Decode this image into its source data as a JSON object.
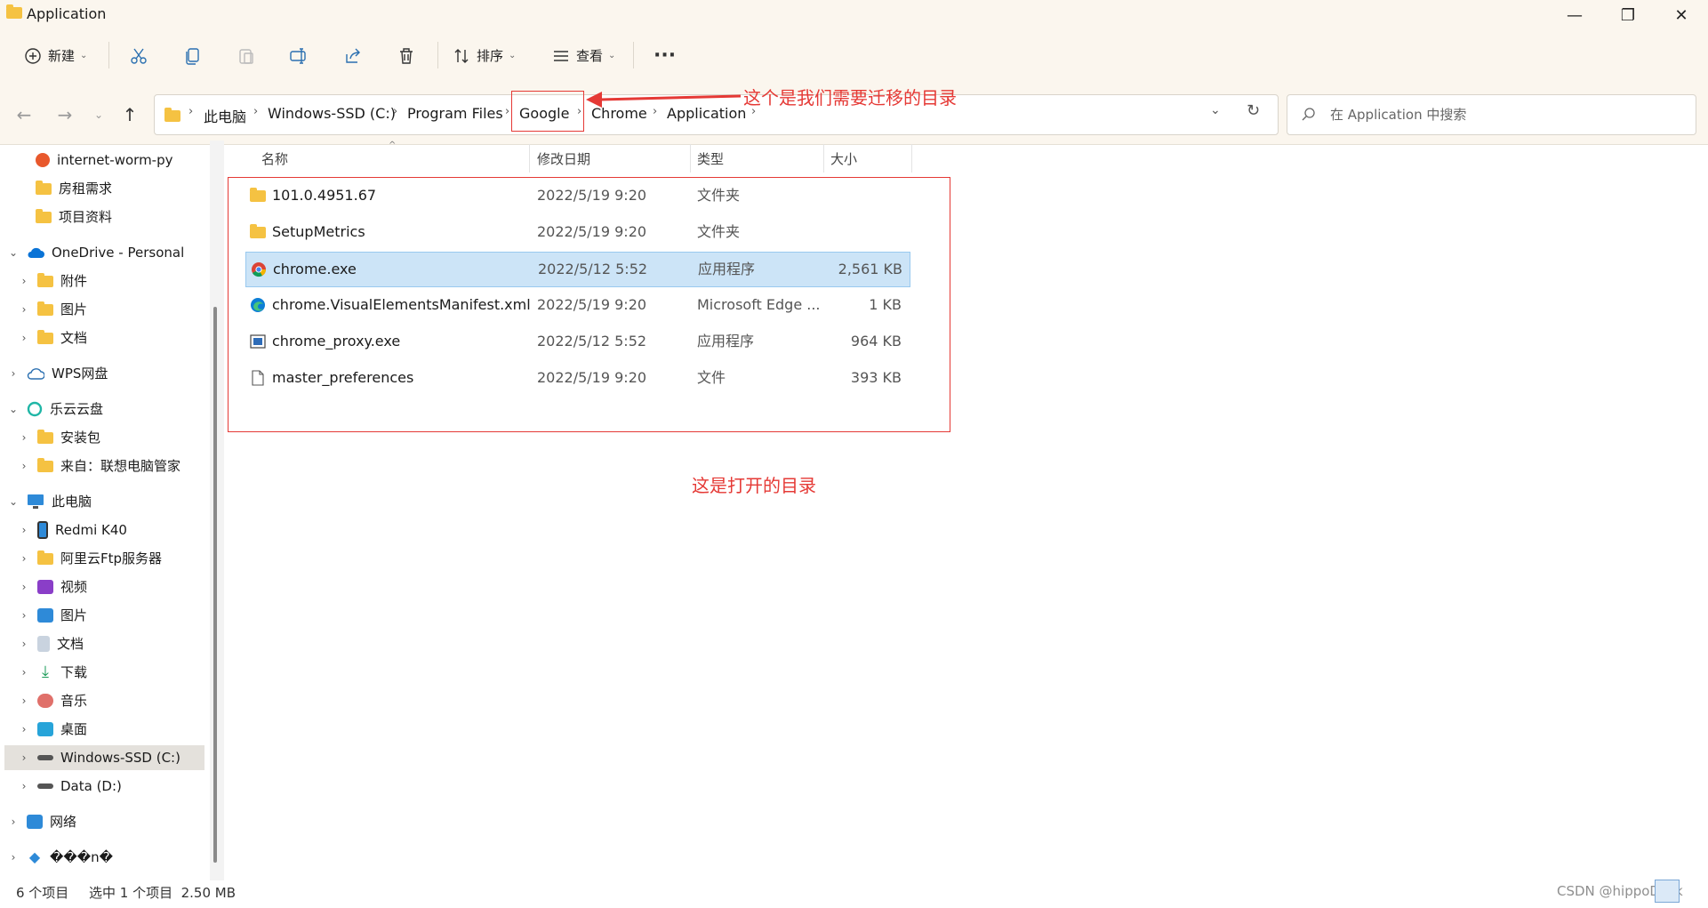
{
  "window": {
    "title": "Application",
    "minimize_glyph": "—",
    "restore_glyph": "❐",
    "close_glyph": "✕"
  },
  "toolbar": {
    "new_label": "新建",
    "sort_label": "排序",
    "view_label": "查看",
    "more_glyph": "···",
    "icons": [
      "cut-icon",
      "copy-icon",
      "paste-icon",
      "rename-icon",
      "share-icon",
      "delete-icon"
    ]
  },
  "address": {
    "crumbs": [
      "此电脑",
      "Windows-SSD (C:)",
      "Program Files",
      "Google",
      "Chrome",
      "Application"
    ],
    "search_placeholder": "在 Application 中搜索"
  },
  "sidebar": {
    "items": [
      {
        "label": "internet-worm-py",
        "icon": "app-icon"
      },
      {
        "label": "房租需求",
        "icon": "folder-icon"
      },
      {
        "label": "项目资料",
        "icon": "folder-icon"
      },
      {
        "label": "OneDrive - Personal",
        "icon": "cloud-icon"
      },
      {
        "label": "附件",
        "icon": "folder-icon"
      },
      {
        "label": "图片",
        "icon": "folder-icon"
      },
      {
        "label": "文档",
        "icon": "folder-icon"
      },
      {
        "label": "WPS网盘",
        "icon": "cloud-outline-icon"
      },
      {
        "label": "乐云云盘",
        "icon": "cloud-app-icon"
      },
      {
        "label": "安装包",
        "icon": "folder-icon"
      },
      {
        "label": "来自：联想电脑管家",
        "icon": "folder-icon"
      },
      {
        "label": "此电脑",
        "icon": "computer-icon"
      },
      {
        "label": "Redmi K40",
        "icon": "phone-icon"
      },
      {
        "label": "阿里云Ftp服务器",
        "icon": "network-folder-icon"
      },
      {
        "label": "视频",
        "icon": "video-icon"
      },
      {
        "label": "图片",
        "icon": "pictures-icon"
      },
      {
        "label": "文档",
        "icon": "documents-icon"
      },
      {
        "label": "下载",
        "icon": "download-icon"
      },
      {
        "label": "音乐",
        "icon": "music-icon"
      },
      {
        "label": "桌面",
        "icon": "desktop-icon"
      },
      {
        "label": "Windows-SSD (C:)",
        "icon": "drive-icon"
      },
      {
        "label": "Data (D:)",
        "icon": "drive-icon"
      },
      {
        "label": "网络",
        "icon": "network-icon"
      },
      {
        "label": "���n�",
        "icon": "diamond-icon"
      }
    ]
  },
  "columns": {
    "name": "名称",
    "date": "修改日期",
    "type": "类型",
    "size": "大小"
  },
  "files": [
    {
      "name": "101.0.4951.67",
      "date": "2022/5/19 9:20",
      "type": "文件夹",
      "size": ""
    },
    {
      "name": "SetupMetrics",
      "date": "2022/5/19 9:20",
      "type": "文件夹",
      "size": ""
    },
    {
      "name": "chrome.exe",
      "date": "2022/5/12 5:52",
      "type": "应用程序",
      "size": "2,561 KB"
    },
    {
      "name": "chrome.VisualElementsManifest.xml",
      "date": "2022/5/19 9:20",
      "type": "Microsoft Edge ...",
      "size": "1 KB"
    },
    {
      "name": "chrome_proxy.exe",
      "date": "2022/5/12 5:52",
      "type": "应用程序",
      "size": "964 KB"
    },
    {
      "name": "master_preferences",
      "date": "2022/5/19 9:20",
      "type": "文件",
      "size": "393 KB"
    }
  ],
  "annotations": {
    "migrate_note": "这个是我们需要迁移的目录",
    "opened_note": "这是打开的目录"
  },
  "status": {
    "count": "6 个项目",
    "selection": "选中 1 个项目  2.50 MB"
  },
  "watermark": "CSDN @hippoDesk",
  "colors": {
    "accent": "#0067c0",
    "annotation": "#e53935",
    "selected_row": "#cce4f7",
    "folder": "#f5c242"
  }
}
